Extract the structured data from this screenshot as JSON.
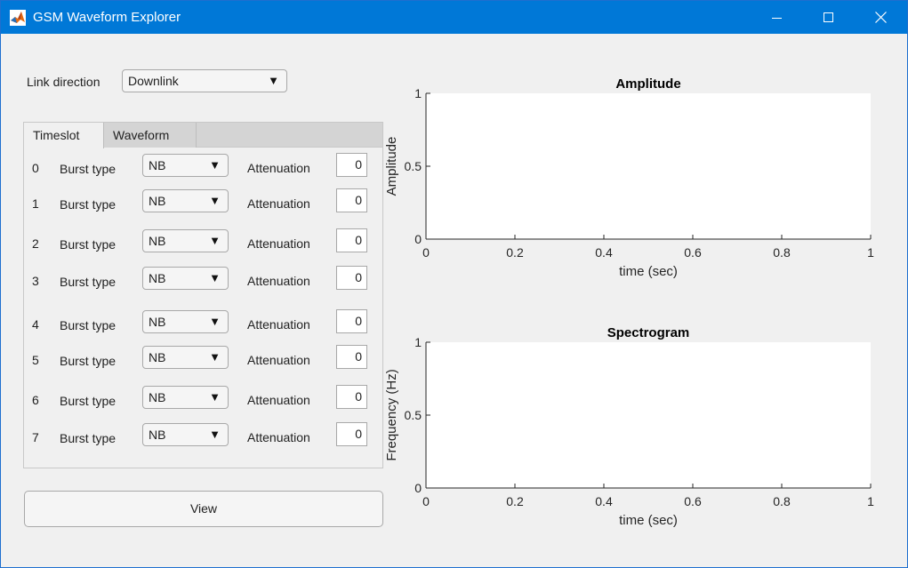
{
  "window": {
    "title": "GSM Waveform Explorer",
    "app_icon": "matlab-icon",
    "controls": {
      "minimize": "minimize-icon",
      "maximize": "maximize-icon",
      "close": "close-icon"
    },
    "accent": "#0078d7"
  },
  "link_direction": {
    "label": "Link direction",
    "value": "Downlink"
  },
  "tabs": [
    {
      "label": "Timeslot",
      "active": true
    },
    {
      "label": "Waveform",
      "active": false
    }
  ],
  "timeslots": [
    {
      "index": "0",
      "burst_label": "Burst type",
      "burst_value": "NB",
      "attenuation_label": "Attenuation",
      "attenuation_value": "0"
    },
    {
      "index": "1",
      "burst_label": "Burst type",
      "burst_value": "NB",
      "attenuation_label": "Attenuation",
      "attenuation_value": "0"
    },
    {
      "index": "2",
      "burst_label": "Burst type",
      "burst_value": "NB",
      "attenuation_label": "Attenuation",
      "attenuation_value": "0"
    },
    {
      "index": "3",
      "burst_label": "Burst type",
      "burst_value": "NB",
      "attenuation_label": "Attenuation",
      "attenuation_value": "0"
    },
    {
      "index": "4",
      "burst_label": "Burst type",
      "burst_value": "NB",
      "attenuation_label": "Attenuation",
      "attenuation_value": "0"
    },
    {
      "index": "5",
      "burst_label": "Burst type",
      "burst_value": "NB",
      "attenuation_label": "Attenuation",
      "attenuation_value": "0"
    },
    {
      "index": "6",
      "burst_label": "Burst type",
      "burst_value": "NB",
      "attenuation_label": "Attenuation",
      "attenuation_value": "0"
    },
    {
      "index": "7",
      "burst_label": "Burst type",
      "burst_value": "NB",
      "attenuation_label": "Attenuation",
      "attenuation_value": "0"
    }
  ],
  "view_button": {
    "label": "View"
  },
  "chart_data": [
    {
      "type": "line",
      "title": "Amplitude",
      "xlabel": "time (sec)",
      "ylabel": "Amplitude",
      "xlim": [
        0,
        1
      ],
      "ylim": [
        0,
        1
      ],
      "xticks": [
        "0",
        "0.2",
        "0.4",
        "0.6",
        "0.8",
        "1"
      ],
      "yticks": [
        "0",
        "0.5",
        "1"
      ],
      "series": [],
      "grid": false
    },
    {
      "type": "heatmap",
      "title": "Spectrogram",
      "xlabel": "time (sec)",
      "ylabel": "Frequency (Hz)",
      "xlim": [
        0,
        1
      ],
      "ylim": [
        0,
        1
      ],
      "xticks": [
        "0",
        "0.2",
        "0.4",
        "0.6",
        "0.8",
        "1"
      ],
      "yticks": [
        "0",
        "0.5",
        "1"
      ],
      "series": [],
      "grid": false
    }
  ]
}
